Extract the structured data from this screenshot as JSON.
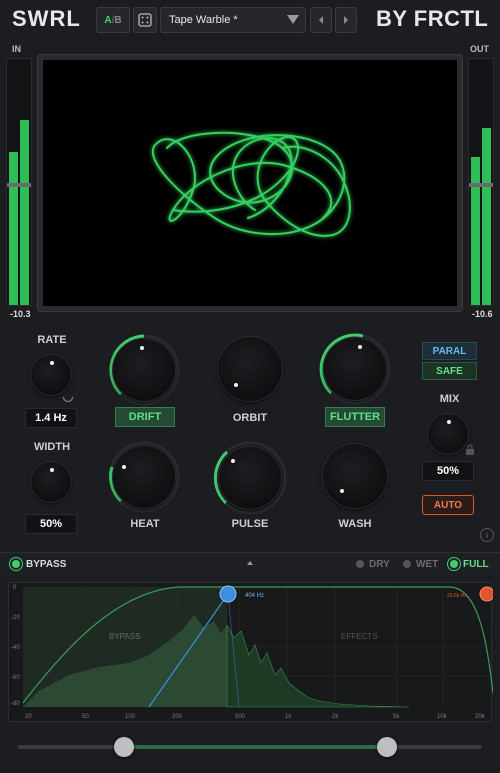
{
  "header": {
    "brand": "SWRL",
    "brand_right": "BY FRCTL",
    "ab_a": "A",
    "ab_sep": "/",
    "ab_b": "B",
    "preset": "Tape Warble *"
  },
  "meters": {
    "in_label": "IN",
    "out_label": "OUT",
    "in_value": "-10.3",
    "out_value": "-10.6",
    "in_levels": [
      0.62,
      0.75
    ],
    "out_levels": [
      0.6,
      0.72
    ]
  },
  "controls": {
    "rate_label": "RATE",
    "rate_value": "1.4 Hz",
    "width_label": "WIDTH",
    "width_value": "50%",
    "drift_label": "DRIFT",
    "orbit_label": "ORBIT",
    "flutter_label": "FLUTTER",
    "heat_label": "HEAT",
    "pulse_label": "PULSE",
    "wash_label": "WASH",
    "paral_label": "PARAL",
    "safe_label": "SAFE",
    "mix_label": "MIX",
    "mix_value": "50%",
    "auto_label": "AUTO",
    "info_label": "i"
  },
  "bypass_bar": {
    "bypass_label": "BYPASS",
    "dry_label": "DRY",
    "wet_label": "WET",
    "full_label": "FULL",
    "selected_mode": "FULL"
  },
  "spectrum": {
    "bypass_region": "BYPASS",
    "effects_region": "EFFECTS",
    "freq_marker": "404 Hz",
    "right_marker": "20.6k Hz",
    "x_ticks": [
      "20",
      "50",
      "100",
      "200",
      "500",
      "1k",
      "2k",
      "5k",
      "10k",
      "20k"
    ],
    "y_ticks": [
      "0",
      "-20",
      "-40",
      "-60",
      "-80"
    ]
  },
  "colors": {
    "accent": "#3fcf6e",
    "blue": "#3b8ee0",
    "orange": "#e2552a"
  }
}
